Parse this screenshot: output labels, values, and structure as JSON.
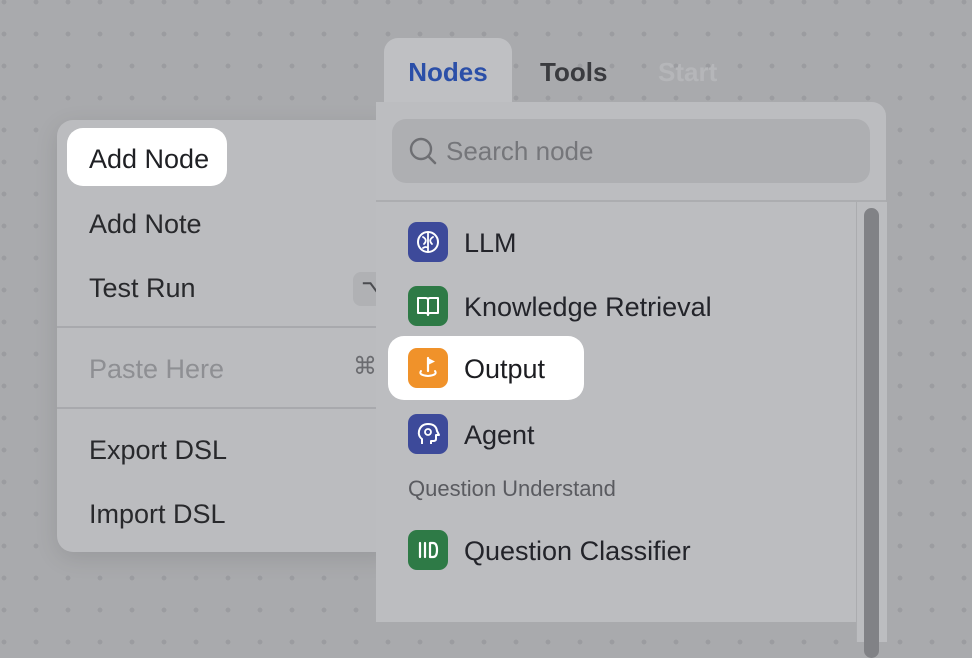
{
  "context_menu": {
    "items": [
      {
        "label": "Add Node",
        "highlighted": true
      },
      {
        "label": "Add Note"
      },
      {
        "label": "Test Run",
        "shortcut": "⌥"
      },
      {
        "label": "Paste Here",
        "shortcut": "⌘",
        "disabled": true
      },
      {
        "label": "Export DSL"
      },
      {
        "label": "Import DSL"
      }
    ]
  },
  "node_panel": {
    "tabs": [
      {
        "label": "Nodes",
        "active": true
      },
      {
        "label": "Tools"
      },
      {
        "label": "Start",
        "disabled": true
      }
    ],
    "search": {
      "placeholder": "Search node",
      "value": ""
    },
    "nodes": [
      {
        "label": "LLM",
        "icon": "llm-brain-icon",
        "color": "#3d4a9a"
      },
      {
        "label": "Knowledge Retrieval",
        "icon": "book-icon",
        "color": "#2e7a46"
      },
      {
        "label": "Output",
        "icon": "flag-pin-icon",
        "color": "#f0922a",
        "highlighted": true
      },
      {
        "label": "Agent",
        "icon": "head-gear-icon",
        "color": "#3d4a9a"
      }
    ],
    "section": "Question Understand",
    "section_nodes": [
      {
        "label": "Question Classifier",
        "icon": "classifier-icon",
        "color": "#2e7a46"
      }
    ]
  }
}
